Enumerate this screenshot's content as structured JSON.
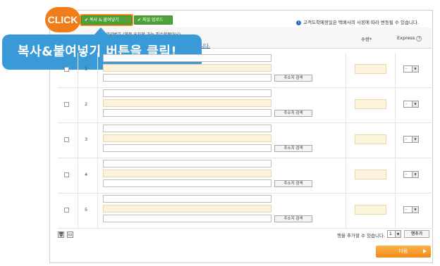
{
  "toolbar": {
    "copy_paste_label": "복사 & 붙여넣기",
    "file_upload_label": "파일 업로드",
    "click_badge": "CLICK",
    "notice": "고객도착예정일은 택배사의 사정에 따라 변동될 수 있습니다."
  },
  "callout": {
    "text": "복사&붙여넣기 버튼을 클릭!"
  },
  "header": {
    "tracking_label": "관리번호 (영문,숫자만 가능,필수항목아님)",
    "link_text": "니다.",
    "qty_label": "수량",
    "qty_required": "*",
    "express_label": "Express",
    "express_help": "?"
  },
  "rows": [
    {
      "number": "1",
      "address_button": "주소지 검색",
      "express_value": "-"
    },
    {
      "number": "2",
      "address_button": "주소지 검색",
      "express_value": "-"
    },
    {
      "number": "3",
      "address_button": "주소지 검색",
      "express_value": "-"
    },
    {
      "number": "4",
      "address_button": "주소지 검색",
      "express_value": "-"
    },
    {
      "number": "5",
      "address_button": "주소지 검색",
      "express_value": "-"
    }
  ],
  "footer": {
    "add_rows_text": "행을 추가할 수 있습니다.",
    "rows_to_add": "1",
    "add_button": "행추가",
    "next_button": "다음"
  },
  "icons": {
    "delete": "trash-icon",
    "folder": "folder-icon",
    "info": "info-icon",
    "dropdown": "chevron-down-icon"
  },
  "colors": {
    "accent_orange": "#f08a17",
    "button_green": "#4fa23a",
    "callout_blue": "#3a9ad8",
    "input_yellow": "#fdf3dc"
  }
}
